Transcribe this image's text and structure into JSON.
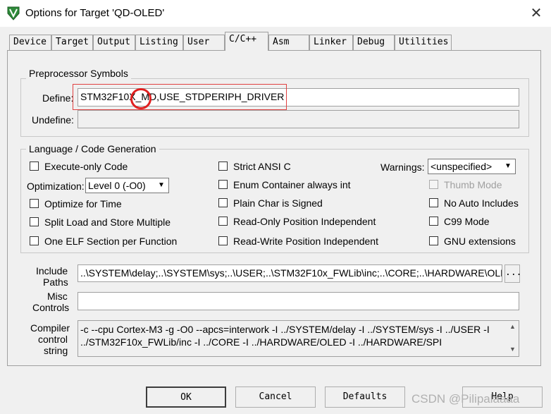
{
  "window": {
    "title": "Options for Target 'QD-OLED'",
    "close_glyph": "✕",
    "icon": "keil-uvision-icon"
  },
  "tabs": [
    {
      "label": "Device"
    },
    {
      "label": "Target"
    },
    {
      "label": "Output"
    },
    {
      "label": "Listing"
    },
    {
      "label": "User"
    },
    {
      "label": "C/C++"
    },
    {
      "label": "Asm"
    },
    {
      "label": "Linker"
    },
    {
      "label": "Debug"
    },
    {
      "label": "Utilities"
    }
  ],
  "active_tab": "C/C++",
  "preprocessor": {
    "group_label": "Preprocessor Symbols",
    "define_label": "Define:",
    "define_value": "STM32F10X_MD,USE_STDPERIPH_DRIVER",
    "undefine_label": "Undefine:",
    "undefine_value": ""
  },
  "language": {
    "group_label": "Language / Code Generation",
    "execute_only": {
      "label": "Execute-only Code",
      "checked": false
    },
    "optimization_label": "Optimization:",
    "optimization_value": "Level 0 (-O0)",
    "optimize_time": {
      "label": "Optimize for Time",
      "checked": false
    },
    "split_load": {
      "label": "Split Load and Store Multiple",
      "checked": false
    },
    "one_elf": {
      "label": "One ELF Section per Function",
      "checked": false
    },
    "strict_ansi": {
      "label": "Strict ANSI C",
      "checked": false
    },
    "enum_int": {
      "label": "Enum Container always int",
      "checked": false
    },
    "plain_char": {
      "label": "Plain Char is Signed",
      "checked": false
    },
    "ropi": {
      "label": "Read-Only Position Independent",
      "checked": false
    },
    "rwpi": {
      "label": "Read-Write Position Independent",
      "checked": false
    },
    "warnings_label": "Warnings:",
    "warnings_value": "<unspecified>",
    "thumb_mode": {
      "label": "Thumb Mode",
      "checked": false,
      "disabled": true
    },
    "no_auto_includes": {
      "label": "No Auto Includes",
      "checked": false
    },
    "c99": {
      "label": "C99 Mode",
      "checked": false
    },
    "gnu_ext": {
      "label": "GNU extensions",
      "checked": false
    }
  },
  "include": {
    "label_line1": "Include",
    "label_line2": "Paths",
    "value": "..\\SYSTEM\\delay;..\\SYSTEM\\sys;..\\USER;..\\STM32F10x_FWLib\\inc;..\\CORE;..\\HARDWARE\\OLED",
    "browse_label": "..."
  },
  "misc": {
    "label_line1": "Misc",
    "label_line2": "Controls",
    "value": ""
  },
  "compiler": {
    "label_line1": "Compiler",
    "label_line2": "control",
    "label_line3": "string",
    "line1": "-c --cpu Cortex-M3 -g -O0 --apcs=interwork -I ../SYSTEM/delay -I ../SYSTEM/sys -I ../USER -I",
    "line2": "../STM32F10x_FWLib/inc -I ../CORE -I ../HARDWARE/OLED -I ../HARDWARE/SPI"
  },
  "buttons": {
    "ok": "OK",
    "cancel": "Cancel",
    "defaults": "Defaults",
    "help": "Help"
  },
  "watermark": "CSDN @Pilipalaaaa",
  "colors": {
    "dialog_bg": "#f0f0f0",
    "highlight_red": "#e02020"
  }
}
